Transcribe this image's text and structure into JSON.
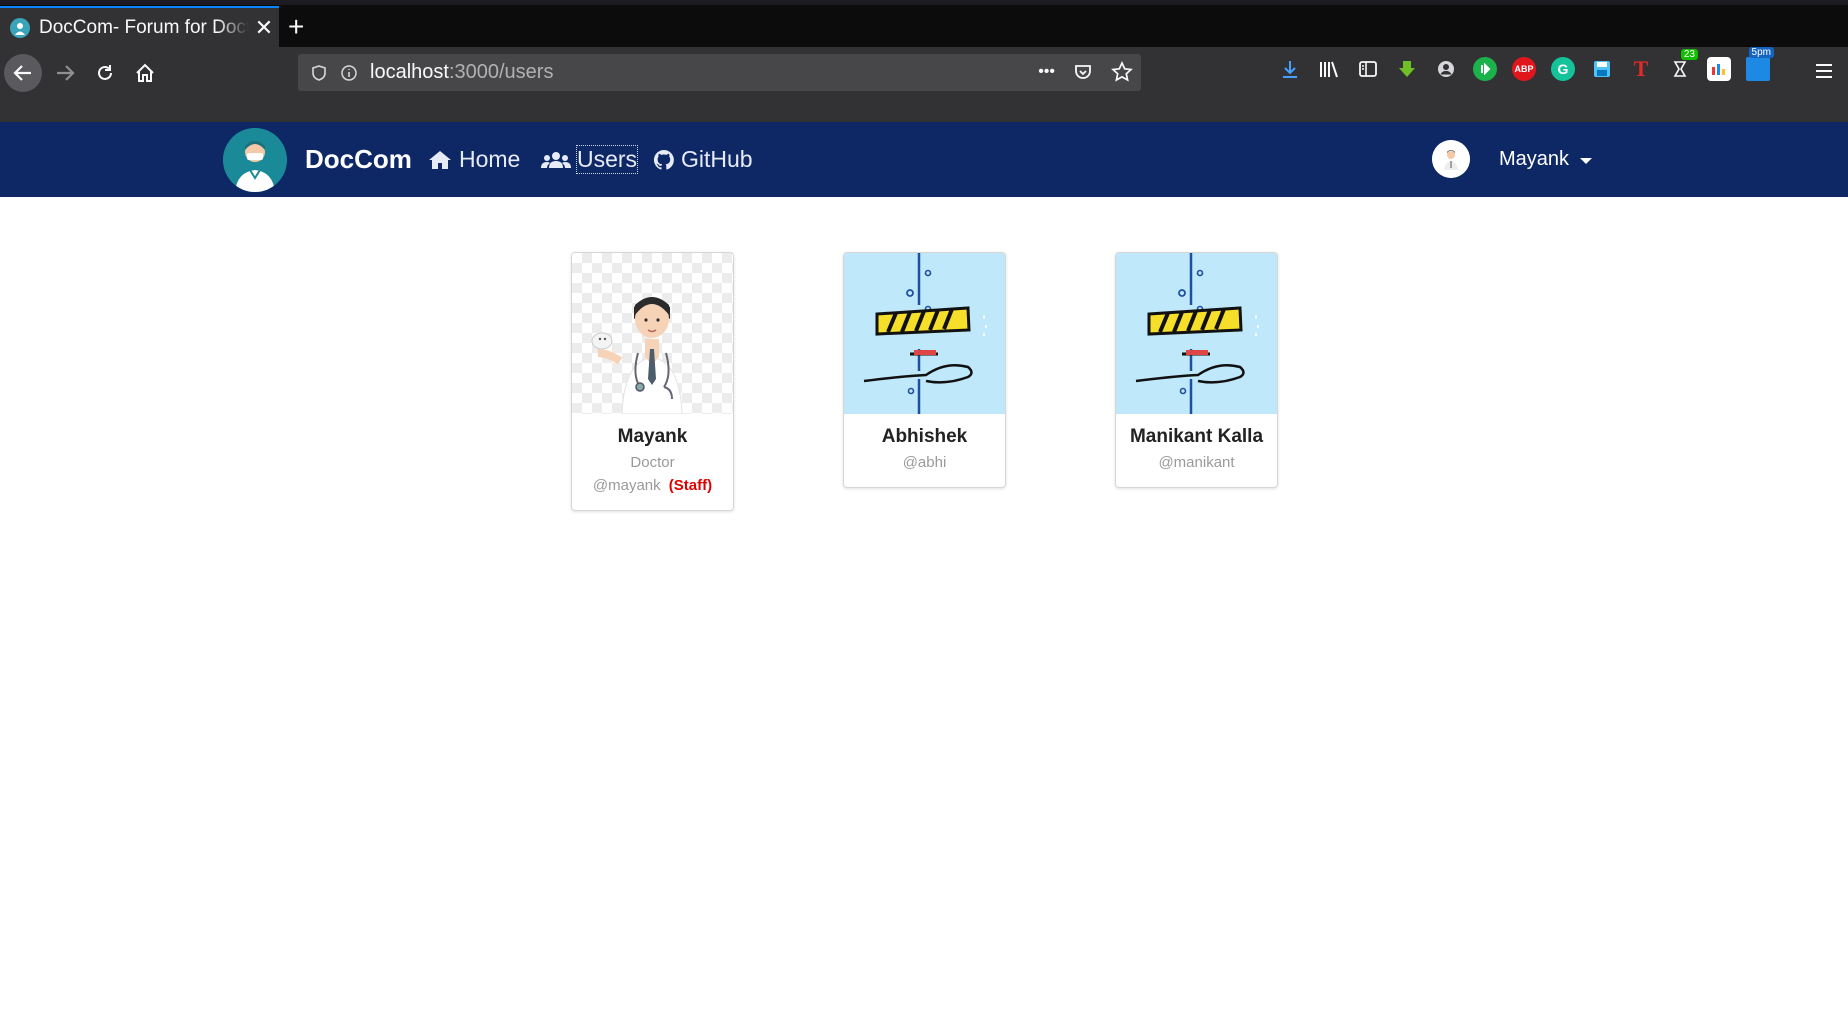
{
  "browser": {
    "tab_title": "DocCom- Forum for Doctors",
    "close_label": "✕",
    "new_tab_label": "+",
    "url_host": "localhost",
    "url_path": ":3000/users",
    "url_dots": "•••",
    "extensions": [
      {
        "name": "download-icon"
      },
      {
        "name": "library-icon"
      },
      {
        "name": "sidebar-icon"
      },
      {
        "name": "green-download-icon"
      },
      {
        "name": "account-icon"
      },
      {
        "name": "extension-green-icon"
      },
      {
        "name": "adblock-icon",
        "label": "ABP"
      },
      {
        "name": "grammarly-icon",
        "label": "G"
      },
      {
        "name": "save-icon"
      },
      {
        "name": "t-extension-icon",
        "label": "T"
      },
      {
        "name": "timer-extension-icon",
        "badge": "23"
      },
      {
        "name": "chart-extension-icon"
      },
      {
        "name": "reminder-extension-icon",
        "badge": "5pm"
      }
    ]
  },
  "navbar": {
    "brand": "DocCom",
    "home": "Home",
    "users": "Users",
    "github": "GitHub",
    "user_name": "Mayank"
  },
  "users": [
    {
      "name": "Mayank",
      "role": "Doctor",
      "handle": "@mayank",
      "staff": "(Staff)"
    },
    {
      "name": "Abhishek",
      "handle": "@abhi"
    },
    {
      "name": "Manikant Kalla",
      "handle": "@manikant"
    }
  ],
  "colors": {
    "navbar": "#0e2866",
    "staff": "#e00000",
    "tab_accent": "#0a84ff"
  }
}
